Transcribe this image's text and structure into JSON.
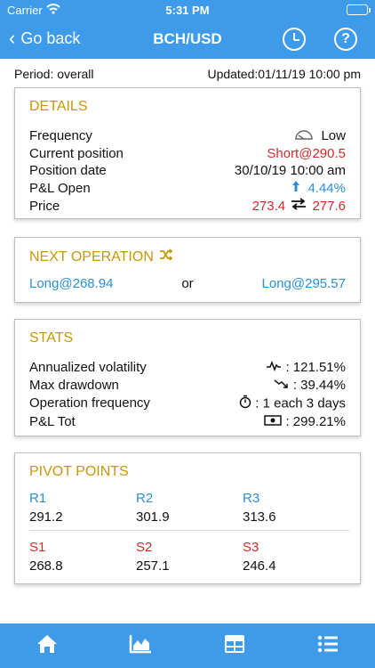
{
  "status": {
    "carrier": "Carrier",
    "time": "5:31 PM"
  },
  "nav": {
    "back_label": "Go back",
    "title": "BCH/USD"
  },
  "meta": {
    "period": "Period: overall",
    "updated": "Updated:01/11/19 10:00 pm"
  },
  "details": {
    "title": "DETAILS",
    "frequency_label": "Frequency",
    "frequency_value": "Low",
    "position_label": "Current position",
    "position_value": "Short@290.5",
    "date_label": "Position date",
    "date_value": "30/10/19 10:00 am",
    "pl_label": "P&L Open",
    "pl_value": "4.44%",
    "price_label": "Price",
    "price_a": "273.4",
    "price_b": "277.6"
  },
  "next_op": {
    "title": "NEXT OPERATION",
    "option_a": "Long@268.94",
    "or": "or",
    "option_b": "Long@295.57"
  },
  "stats": {
    "title": "STATS",
    "vol_label": "Annualized volatility",
    "vol_value": ": 121.51%",
    "dd_label": "Max drawdown",
    "dd_value": ": 39.44%",
    "freq_label": "Operation frequency",
    "freq_value": ": 1 each 3 days",
    "pl_label": "P&L Tot",
    "pl_value": ": 299.21%"
  },
  "pivots": {
    "title": "PIVOT POINTS",
    "r1_label": "R1",
    "r2_label": "R2",
    "r3_label": "R3",
    "r1": "291.2",
    "r2": "301.9",
    "r3": "313.6",
    "s1_label": "S1",
    "s2_label": "S2",
    "s3_label": "S3",
    "s1": "268.8",
    "s2": "257.1",
    "s3": "246.4"
  },
  "colors": {
    "brand": "#3d9be9",
    "gold": "#c8960a",
    "red": "#d42a2a",
    "blue": "#2a8fd6"
  },
  "icons": [
    "chevron-left-icon",
    "clock-icon",
    "help-icon",
    "gauge-icon",
    "arrow-up-icon",
    "swap-icon",
    "shuffle-icon",
    "pulse-icon",
    "trend-down-icon",
    "stopwatch-icon",
    "money-icon",
    "home-icon",
    "chart-icon",
    "grid-icon",
    "list-icon"
  ]
}
